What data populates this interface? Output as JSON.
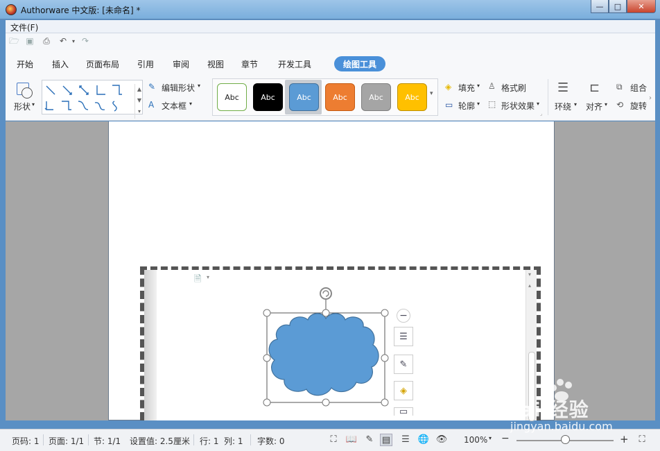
{
  "window": {
    "title": "Authorware 中文版: [未命名] *",
    "minimize": "—",
    "maximize": "□",
    "close": "✕"
  },
  "menubar": {
    "file": "文件(F)"
  },
  "quickbar": {
    "icons": [
      "open-icon",
      "save-icon",
      "print-icon",
      "undo-icon",
      "redo-icon"
    ]
  },
  "tabs": [
    "开始",
    "插入",
    "页面布局",
    "引用",
    "审阅",
    "视图",
    "章节",
    "开发工具",
    "绘图工具"
  ],
  "active_tab": "绘图工具",
  "ribbon": {
    "shape_label": "形状",
    "edit_shape": "编辑形状",
    "text_box": "文本框",
    "styles": [
      {
        "label": "Abc",
        "bg": "#ffffff",
        "border": "#70ad47",
        "color": "#222222"
      },
      {
        "label": "Abc",
        "bg": "#000000",
        "border": "#000000",
        "color": "#ffffff"
      },
      {
        "label": "Abc",
        "bg": "#5b9bd5",
        "border": "#41719c",
        "color": "#ffffff"
      },
      {
        "label": "Abc",
        "bg": "#ed7d31",
        "border": "#c55a11",
        "color": "#ffffff"
      },
      {
        "label": "Abc",
        "bg": "#a5a5a5",
        "border": "#7f7f7f",
        "color": "#ffffff"
      },
      {
        "label": "Abc",
        "bg": "#ffc000",
        "border": "#bf9000",
        "color": "#ffffff"
      }
    ],
    "fill": "填充",
    "format_painter": "格式刷",
    "outline": "轮廓",
    "shape_effect": "形状效果",
    "wrap": "环绕",
    "align": "对齐",
    "group": "组合",
    "rotate": "旋转"
  },
  "document": {
    "shape_fill": "#5b9bd5",
    "shape_stroke": "#41719c"
  },
  "statusbar": {
    "page_no": "页码: 1",
    "pages": "页面: 1/1",
    "section": "节: 1/1",
    "setting": "设置值: 2.5厘米",
    "row": "行: 1",
    "col": "列: 1",
    "words": "字数: 0",
    "zoom": "100%",
    "zoom_level": 0.5
  },
  "watermark": {
    "main": "Bai 经验",
    "sub": "jingyan.baidu.com"
  }
}
